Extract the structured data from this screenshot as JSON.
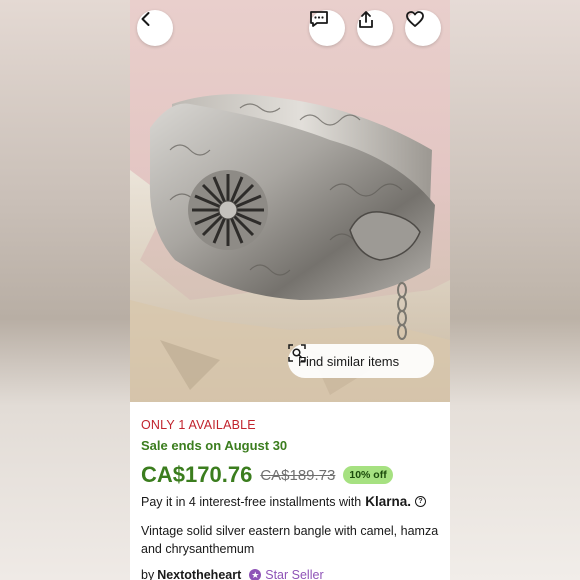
{
  "availability": "ONLY 1 AVAILABLE",
  "sale": "Sale ends on August 30",
  "price": {
    "current": "CA$170.76",
    "original": "CA$189.73",
    "discount": "10% off"
  },
  "installments": {
    "text": "Pay it in 4 interest-free installments with",
    "provider": "Klarna.",
    "info_icon": "?"
  },
  "title": "Vintage solid silver eastern bangle with camel, hamza and chrysanthemum",
  "seller": {
    "prefix": "by",
    "name": "Nextotheheart",
    "badge": "Star Seller"
  },
  "image_actions": {
    "find_similar": "Find similar items"
  },
  "icons": {
    "back": "chevron-left-icon",
    "message": "message-icon",
    "share": "share-icon",
    "favorite": "heart-icon",
    "camera_search": "camera-search-icon"
  },
  "colors": {
    "availability": "#c1232d",
    "sale": "#3b7d1e",
    "badge_bg": "#a6e181",
    "star_seller": "#8f54b7"
  }
}
